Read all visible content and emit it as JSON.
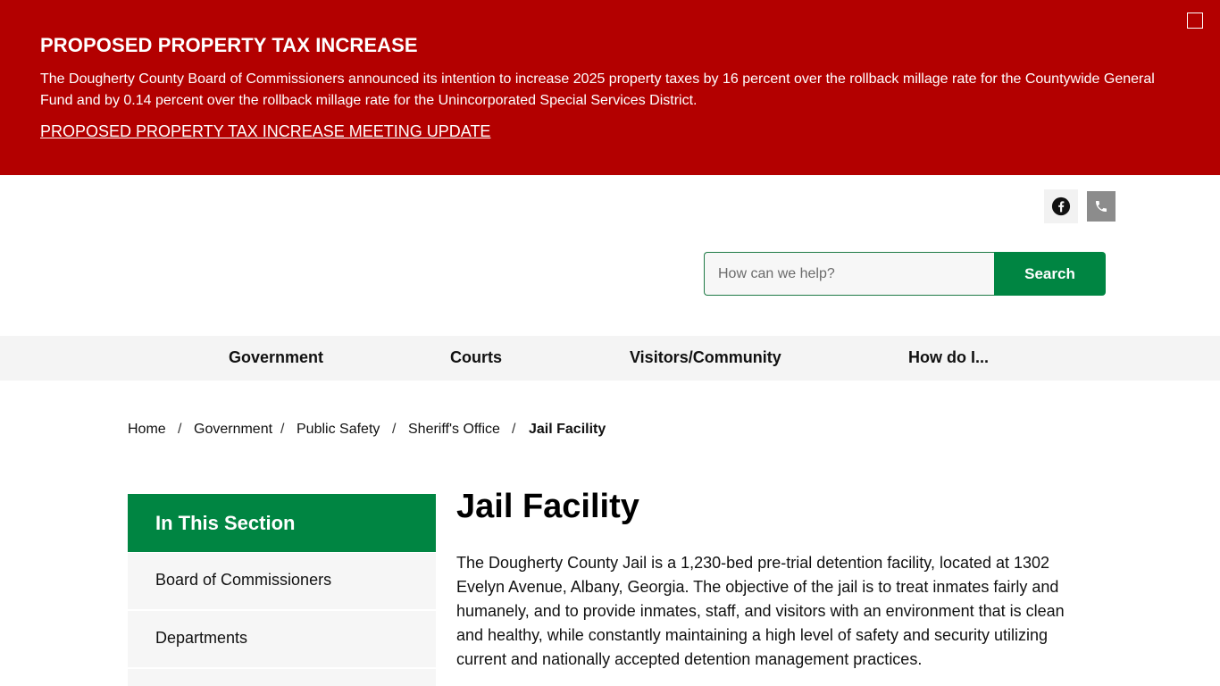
{
  "alert": {
    "title": "PROPOSED PROPERTY TAX INCREASE",
    "body": "The Dougherty County Board of Commissioners announced its intention to increase 2025 property taxes by 16 percent over the rollback millage rate for the Countywide General Fund and by 0.14 percent over the rollback millage rate for the Unincorporated Special Services District.",
    "link": "PROPOSED PROPERTY TAX INCREASE MEETING UPDATE",
    "bg_color": "#b30000"
  },
  "social": {
    "facebook_icon": "facebook-icon",
    "phone_icon": "phone-icon"
  },
  "search": {
    "placeholder": "How can we help?",
    "button": "Search",
    "accent": "#008542"
  },
  "nav": {
    "items": [
      "Government",
      "Courts",
      "Visitors/Community",
      "How do I..."
    ]
  },
  "breadcrumb": {
    "items": [
      "Home",
      "Government",
      "Public Safety",
      "Sheriff's Office"
    ],
    "current": "Jail Facility"
  },
  "sidebar": {
    "heading": "In This Section",
    "items": [
      "Board of Commissioners",
      "Departments"
    ]
  },
  "main": {
    "title": "Jail Facility",
    "body": "The Dougherty County Jail is a 1,230-bed pre-trial detention facility, located at 1302 Evelyn Avenue, Albany, Georgia. The objective of the jail is to treat inmates fairly and humanely, and to provide inmates, staff, and visitors with an environment that is clean and healthy, while constantly maintaining a high level of safety and security utilizing current and nationally accepted detention management practices."
  }
}
